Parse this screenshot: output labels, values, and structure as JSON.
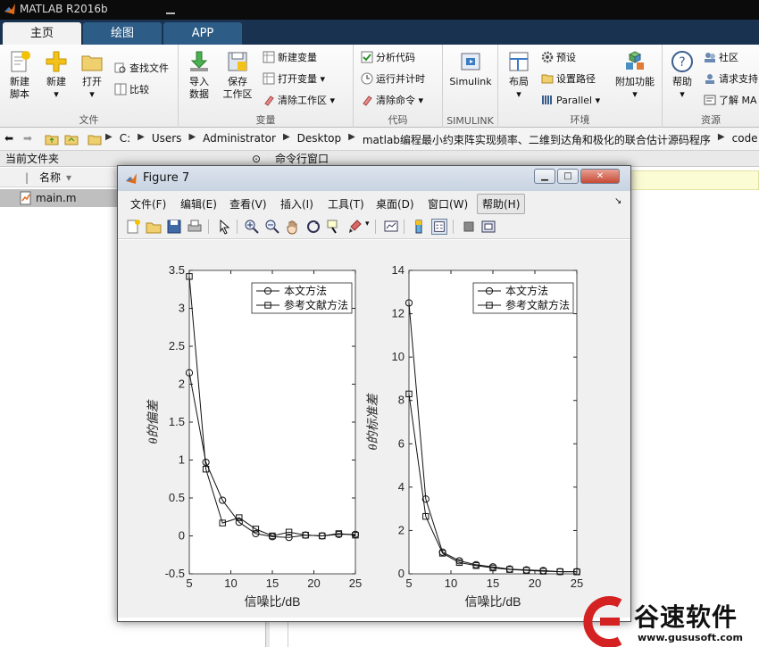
{
  "app": {
    "title": "MATLAB R2016b"
  },
  "tabs": [
    {
      "label": "主页"
    },
    {
      "label": "绘图"
    },
    {
      "label": "APP"
    }
  ],
  "ribbon": {
    "file": {
      "group_label": "文件",
      "new_script": "新建\n脚本",
      "new": "新建",
      "open": "打开",
      "find_files": "查找文件",
      "compare": "比较"
    },
    "variable": {
      "group_label": "变量",
      "import_data": "导入\n数据",
      "save_workspace": "保存\n工作区",
      "new_variable": "新建变量",
      "open_variable": "打开变量",
      "clear_workspace": "清除工作区"
    },
    "code": {
      "group_label": "代码",
      "analyze_code": "分析代码",
      "run_and_time": "运行并计时",
      "clear_commands": "清除命令"
    },
    "simulink": {
      "group_label": "SIMULINK",
      "simulink": "Simulink"
    },
    "environment": {
      "group_label": "环境",
      "layout": "布局",
      "preferences": "预设",
      "set_path": "设置路径",
      "parallel": "Parallel",
      "add_ons": "附加功能"
    },
    "resources": {
      "group_label": "资源",
      "help": "帮助",
      "community": "社区",
      "request_support": "请求支持",
      "learn_matlab": "了解 MA"
    }
  },
  "address": {
    "crumbs": [
      "C:",
      "Users",
      "Administrator",
      "Desktop",
      "matlab编程最小约束阵实现频率、二维到达角和极化的联合估计源码程序",
      "code"
    ]
  },
  "current_folder": {
    "title": "当前文件夹",
    "column_name": "名称",
    "files": [
      "main.m"
    ]
  },
  "command_window": {
    "title": "命令行窗口"
  },
  "figure": {
    "title": "Figure 7",
    "menu": [
      "文件(F)",
      "编辑(E)",
      "查看(V)",
      "插入(I)",
      "工具(T)",
      "桌面(D)",
      "窗口(W)",
      "帮助(H)"
    ]
  },
  "watermark": {
    "brand": "谷速软件",
    "url": "www.gususoft.com"
  },
  "chart_data": [
    {
      "type": "line",
      "xlabel": "信噪比/dB",
      "ylabel": "θ的偏差",
      "xlim": [
        5,
        25
      ],
      "ylim": [
        -0.5,
        3.5
      ],
      "xticks": [
        "5",
        "10",
        "15",
        "20",
        "25"
      ],
      "yticks": [
        "-0.5",
        "0",
        "0.5",
        "1",
        "1.5",
        "2",
        "2.5",
        "3",
        "3.5"
      ],
      "legend_position": "top-right",
      "x": [
        5,
        7,
        9,
        11,
        13,
        15,
        17,
        19,
        21,
        23,
        25
      ],
      "series": [
        {
          "name": "本文方法",
          "marker": "circle",
          "values": [
            2.15,
            0.97,
            0.47,
            0.18,
            0.03,
            -0.01,
            -0.02,
            0.01,
            0.0,
            0.02,
            0.02
          ]
        },
        {
          "name": "参考文献方法",
          "marker": "square",
          "values": [
            3.42,
            0.88,
            0.17,
            0.24,
            0.09,
            0.0,
            0.05,
            0.01,
            0.0,
            0.03,
            0.01
          ]
        }
      ]
    },
    {
      "type": "line",
      "xlabel": "信噪比/dB",
      "ylabel": "θ的标准差",
      "xlim": [
        5,
        25
      ],
      "ylim": [
        0,
        14
      ],
      "xticks": [
        "5",
        "10",
        "15",
        "20",
        "25"
      ],
      "yticks": [
        "0",
        "2",
        "4",
        "6",
        "8",
        "10",
        "12",
        "14"
      ],
      "legend_position": "top-right",
      "x": [
        5,
        7,
        9,
        11,
        13,
        15,
        17,
        19,
        21,
        23,
        25
      ],
      "series": [
        {
          "name": "本文方法",
          "marker": "circle",
          "values": [
            12.5,
            3.45,
            1.0,
            0.6,
            0.42,
            0.32,
            0.22,
            0.18,
            0.15,
            0.1,
            0.1
          ]
        },
        {
          "name": "参考文献方法",
          "marker": "square",
          "values": [
            8.3,
            2.65,
            0.95,
            0.52,
            0.38,
            0.27,
            0.2,
            0.16,
            0.12,
            0.1,
            0.09
          ]
        }
      ]
    }
  ]
}
